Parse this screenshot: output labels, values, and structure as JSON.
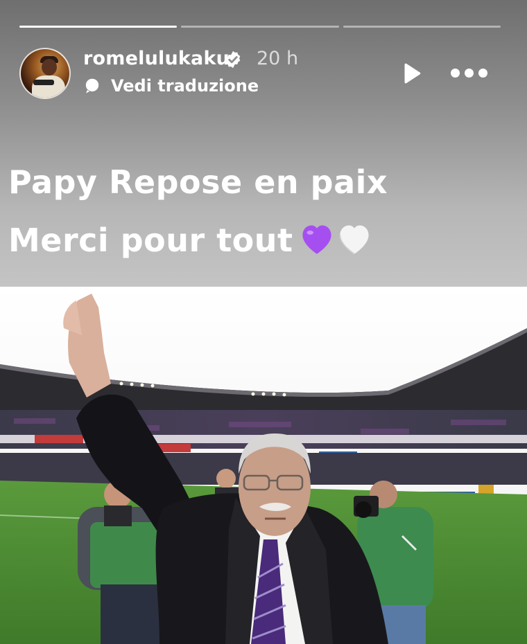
{
  "story": {
    "progress": [
      1.0,
      0.0,
      0.0
    ],
    "user": {
      "username": "romelulukaku",
      "verified": true,
      "time_ago": "20 h"
    },
    "translate_label": "Vedi traduzione",
    "icons": {
      "play": "play-icon",
      "more": "more-options-icon",
      "translate": "translate-icon",
      "verified": "verified-badge-icon"
    },
    "caption": {
      "line1": "Papy Repose en paix",
      "line2": "Merci pour tout",
      "emojis": [
        "purple-heart",
        "white-heart"
      ]
    },
    "colors": {
      "purple_heart": "#a64ff0",
      "white_heart": "#f4f4f4",
      "pitch": "#4f8a34"
    }
  }
}
